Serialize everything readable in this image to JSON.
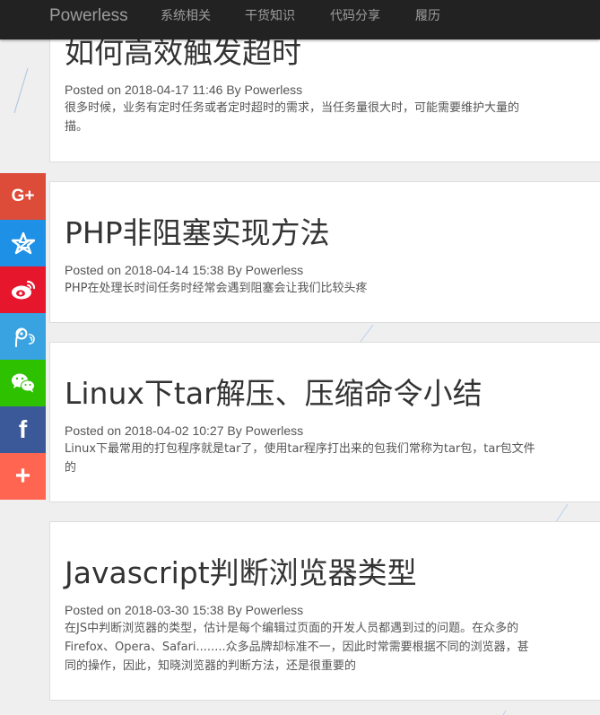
{
  "site": {
    "brand": "Powerless"
  },
  "nav": [
    "系统相关",
    "干货知识",
    "代码分享",
    "履历"
  ],
  "share": [
    {
      "icon": "google-plus-icon",
      "label": "G+",
      "color": "#dd4b39"
    },
    {
      "icon": "qzone-icon",
      "color": "#1e90e5"
    },
    {
      "icon": "weibo-icon",
      "color": "#e6162d"
    },
    {
      "icon": "tencent-weibo-icon",
      "color": "#38a3e0"
    },
    {
      "icon": "wechat-icon",
      "color": "#2dc100"
    },
    {
      "icon": "facebook-icon",
      "label": "f",
      "color": "#3b5998"
    },
    {
      "icon": "plus-icon",
      "label": "+",
      "color": "#ff6550"
    }
  ],
  "posts": [
    {
      "title": "如何高效触发超时",
      "meta": "Posted on 2018-04-17 11:46 By Powerless",
      "excerpt_lines": [
        "很多时候，业务有定时任务或者定时超时的需求，当任务量很大时，可能需要维护大量的",
        "描。"
      ]
    },
    {
      "title": "PHP非阻塞实现方法",
      "meta": "Posted on 2018-04-14 15:38 By Powerless",
      "excerpt_lines": [
        "PHP在处理长时间任务时经常会遇到阻塞会让我们比较头疼"
      ]
    },
    {
      "title": "Linux下tar解压、压缩命令小结",
      "meta": "Posted on 2018-04-02 10:27 By Powerless",
      "excerpt_lines": [
        "Linux下最常用的打包程序就是tar了，使用tar程序打出来的包我们常称为tar包，tar包文件",
        "的"
      ]
    },
    {
      "title": "Javascript判断浏览器类型",
      "meta": "Posted on 2018-03-30 15:38 By Powerless",
      "excerpt_lines": [
        "在JS中判断浏览器的类型，估计是每个编辑过页面的开发人员都遇到过的问题。在众多的",
        "Firefox、Opera、Safari........众多品牌却标准不一，因此时常需要根据不同的浏览器，甚",
        "同的操作，因此，知晓浏览器的判断方法，还是很重要的"
      ]
    }
  ]
}
